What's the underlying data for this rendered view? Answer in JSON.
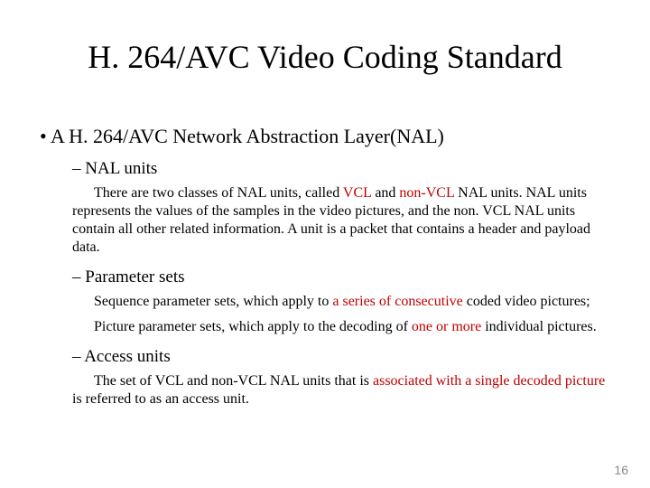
{
  "title": "H. 264/AVC Video Coding Standard",
  "bullet_level1": "A H. 264/AVC Network Abstraction Layer(NAL)",
  "sec1": {
    "heading": "NAL units",
    "para_a": "There are two classes of NAL units, called ",
    "para_b_hl": "VCL",
    "para_c": " and ",
    "para_d_hl": "non-VCL",
    "para_e": " NAL units. NAL units represents the values of the samples in the video pictures, and the non. VCL NAL units contain all other related information. A unit is a  packet that contains a header and payload data."
  },
  "sec2": {
    "heading": "Parameter sets",
    "p1_a": "Sequence parameter sets, which apply to ",
    "p1_b_hl": "a series of consecutive",
    "p1_c": " coded video pictures;",
    "p2_a": "Picture parameter sets, which apply to the decoding of ",
    "p2_b_hl": "one or more",
    "p2_c": " individual pictures."
  },
  "sec3": {
    "heading": "Access units",
    "p_a": "The set of VCL and non-VCL NAL units that is ",
    "p_b_hl": "associated with a single decoded picture",
    "p_c": " is referred to as an access unit."
  },
  "page_number": "16"
}
